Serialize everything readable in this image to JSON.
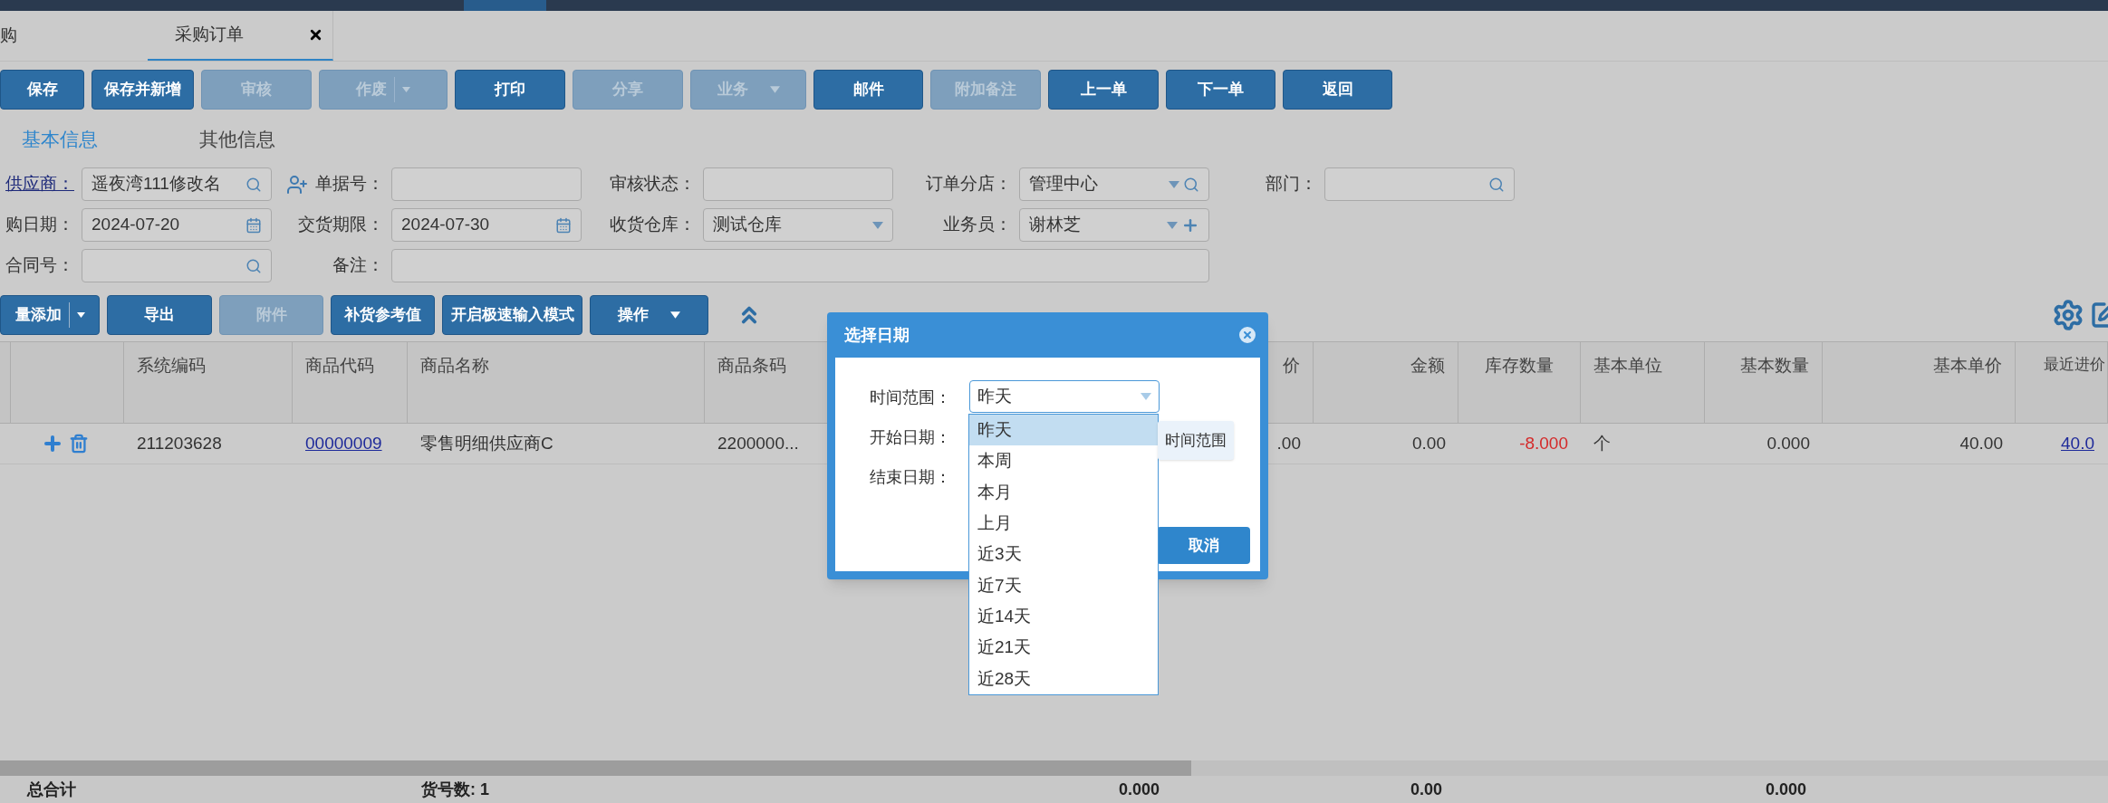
{
  "page_tabs": [
    {
      "label": "购",
      "selected": false,
      "closable": false
    },
    {
      "label": "采购订单",
      "selected": true,
      "closable": true
    }
  ],
  "toolbar": [
    {
      "label": "保存",
      "kind": "button",
      "disabled": false
    },
    {
      "label": "保存并新增",
      "kind": "button",
      "disabled": false
    },
    {
      "label": "审核",
      "kind": "button",
      "disabled": true
    },
    {
      "label": "作废",
      "kind": "split",
      "disabled": true
    },
    {
      "label": "打印",
      "kind": "button",
      "disabled": false
    },
    {
      "label": "分享",
      "kind": "button",
      "disabled": true
    },
    {
      "label": "业务",
      "kind": "menu",
      "disabled": true
    },
    {
      "label": "邮件",
      "kind": "button",
      "disabled": false
    },
    {
      "label": "附加备注",
      "kind": "button",
      "disabled": true
    },
    {
      "label": "上一单",
      "kind": "button",
      "disabled": false
    },
    {
      "label": "下一单",
      "kind": "button",
      "disabled": false
    },
    {
      "label": "返回",
      "kind": "button",
      "disabled": false
    }
  ],
  "info_tabs": [
    {
      "label": "基本信息",
      "selected": true
    },
    {
      "label": "其他信息",
      "selected": false
    }
  ],
  "form_rows": [
    [
      {
        "label": "供应商：",
        "link": true,
        "kind": "search",
        "value": "遥夜湾111修改名"
      },
      {
        "label": "单据号：",
        "link": false,
        "user_icon": true,
        "kind": "plain"
      },
      {
        "label": "审核状态：",
        "link": false,
        "kind": "plain"
      },
      {
        "label": "订单分店：",
        "link": false,
        "kind": "select-search",
        "value": "管理中心"
      },
      {
        "label": "部门：",
        "link": false,
        "kind": "search"
      }
    ],
    [
      {
        "label": "购日期：",
        "link": false,
        "kind": "calendar",
        "value": "2024-07-20"
      },
      {
        "label": "交货期限：",
        "link": false,
        "kind": "calendar",
        "value": "2024-07-30"
      },
      {
        "label": "收货仓库：",
        "link": false,
        "kind": "select",
        "value": "测试仓库"
      },
      {
        "label": "业务员：",
        "link": false,
        "kind": "select-plus",
        "value": "谢林芝"
      }
    ],
    [
      {
        "label": "合同号：",
        "link": false,
        "kind": "search"
      },
      {
        "label": "备注：",
        "link": false,
        "kind": "note"
      }
    ]
  ],
  "actions": [
    {
      "label": "量添加",
      "kind": "split",
      "disabled": false
    },
    {
      "label": "导出",
      "kind": "button",
      "disabled": false
    },
    {
      "label": "附件",
      "kind": "button",
      "disabled": true
    },
    {
      "label": "补货参考值",
      "kind": "button",
      "disabled": false
    },
    {
      "label": "开启极速输入模式",
      "kind": "button",
      "disabled": false
    },
    {
      "label": "操作",
      "kind": "menu",
      "disabled": false
    }
  ],
  "table": {
    "columns": [
      "系统编码",
      "商品代码",
      "商品名称",
      "商品条码",
      "价",
      "金额",
      "库存数量",
      "基本单位",
      "基本数量",
      "基本单价",
      "最近进价"
    ],
    "rows": [
      [
        {
          "kind": "text",
          "text": "211203628"
        },
        {
          "kind": "link",
          "text": "00000009"
        },
        {
          "kind": "text",
          "text": "零售明细供应商C"
        },
        {
          "kind": "text",
          "text": "2200000..."
        },
        {
          "kind": "text",
          "text": ".00"
        },
        {
          "kind": "text",
          "text": "0.00"
        },
        {
          "kind": "negative",
          "text": "-8.000"
        },
        {
          "kind": "text",
          "text": "个"
        },
        {
          "kind": "text",
          "text": "0.000"
        },
        {
          "kind": "text",
          "text": "40.00"
        },
        {
          "kind": "link",
          "text": "40.0"
        }
      ]
    ]
  },
  "totals": [
    "总合计",
    "货号数: 1",
    "0.000",
    "0.00",
    "0.000"
  ],
  "dialog": {
    "title": "选择日期",
    "fields": [
      {
        "label": "时间范围：",
        "kind": "select",
        "value": "昨天"
      },
      {
        "label": "开始日期：",
        "kind": "hidden"
      },
      {
        "label": "结束日期：",
        "kind": "hidden"
      }
    ],
    "button": "取消",
    "options": [
      {
        "label": "昨天",
        "selected": true
      },
      {
        "label": "本周",
        "selected": false
      },
      {
        "label": "本月",
        "selected": false
      },
      {
        "label": "上月",
        "selected": false
      },
      {
        "label": "近3天",
        "selected": false
      },
      {
        "label": "近7天",
        "selected": false
      },
      {
        "label": "近14天",
        "selected": false
      },
      {
        "label": "近21天",
        "selected": false
      },
      {
        "label": "近28天",
        "selected": false
      }
    ],
    "tooltip": "时间范围"
  }
}
